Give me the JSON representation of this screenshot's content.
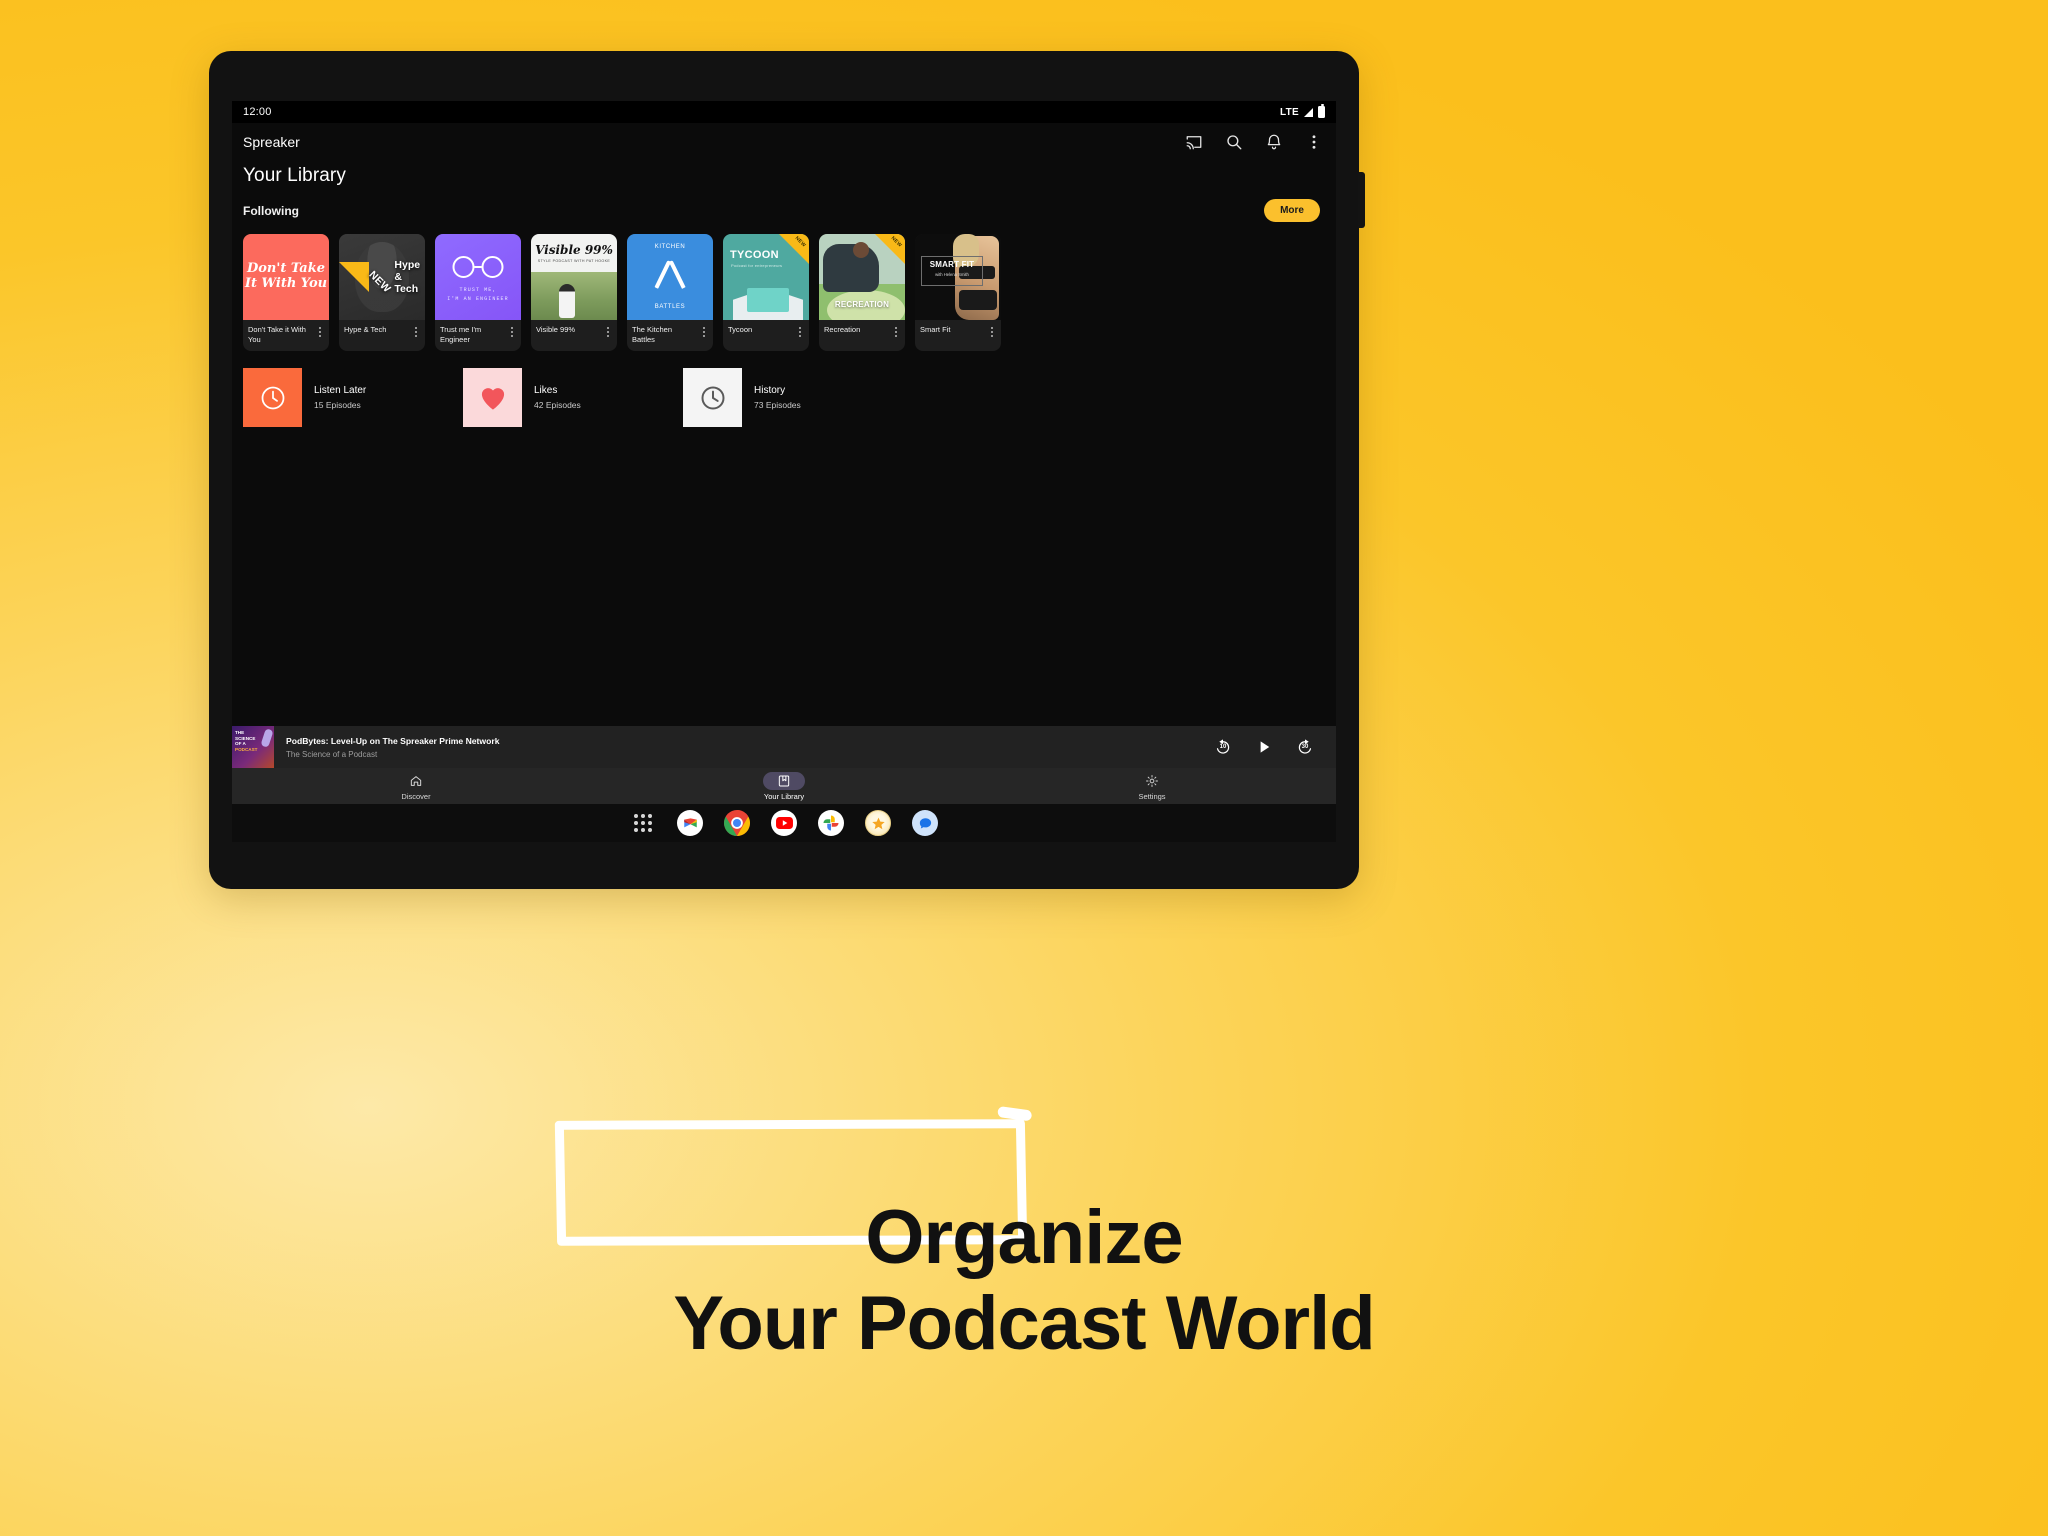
{
  "device": {
    "camera_icon": "front-camera-lens"
  },
  "status_bar": {
    "time": "12:00",
    "network": "LTE",
    "signal_icon": "signal-bars-icon",
    "battery_icon": "battery-full-icon"
  },
  "app_bar": {
    "title": "Spreaker",
    "icons": [
      {
        "name": "cast-icon"
      },
      {
        "name": "search-icon"
      },
      {
        "name": "notifications-bell-icon"
      },
      {
        "name": "overflow-menu-icon"
      }
    ]
  },
  "page": {
    "title": "Your Library",
    "section_label": "Following",
    "more_label": "More"
  },
  "following": [
    {
      "title": "Don't Take it With You",
      "art_title": "Don't Take It With You",
      "badge": "",
      "art": "dont"
    },
    {
      "title": "Hype & Tech",
      "art_title": "Hype & Tech",
      "badge": "NEW",
      "art": "hype"
    },
    {
      "title": "Trust me I'm Engineer",
      "art_line1": "TRUST ME,",
      "art_line2": "I'M AN ENGINEER",
      "badge": "",
      "art": "trust"
    },
    {
      "title": "Visible 99%",
      "art_title": "Visible 99%",
      "art_sub": "STYLE PODCAST WITH PAT HOOKE",
      "badge": "",
      "art": "visible"
    },
    {
      "title": "The Kitchen Battles",
      "art_line1": "KITCHEN",
      "art_line2": "BATTLES",
      "badge": "",
      "art": "kitchen"
    },
    {
      "title": "Tycoon",
      "art_title": "TYCOON",
      "art_sub": "Podcast for entrepreneurs",
      "badge": "NEW",
      "art": "tycoon"
    },
    {
      "title": "Recreation",
      "art_title": "RECREATION",
      "badge": "NEW",
      "art": "recreation"
    },
    {
      "title": "Smart Fit",
      "art_title": "SMART FIT",
      "art_sub": "with Helena Smith",
      "badge": "",
      "art": "smartfit"
    }
  ],
  "quick_rows": [
    {
      "title": "Listen Later",
      "subtitle": "15 Episodes",
      "icon": "clock-icon",
      "color": "#FA6A3C"
    },
    {
      "title": "Likes",
      "subtitle": "42 Episodes",
      "icon": "heart-icon",
      "color": "#FBD9DA"
    },
    {
      "title": "History",
      "subtitle": "73 Episodes",
      "icon": "history-clock-icon",
      "color": "#F4F4F4"
    }
  ],
  "player": {
    "artwork_line1": "THE",
    "artwork_line2": "SCIENCE",
    "artwork_line3": "OF A",
    "artwork_line4": "PODCAST",
    "title": "PodBytes: Level-Up on The Spreaker Prime Network",
    "subtitle": "The Science of a Podcast",
    "rewind_label": "10",
    "forward_label": "30",
    "play_icon": "play-icon"
  },
  "bottom_nav": [
    {
      "label": "Discover",
      "icon": "home-icon",
      "active": false
    },
    {
      "label": "Your Library",
      "icon": "library-bookmark-icon",
      "active": true
    },
    {
      "label": "Settings",
      "icon": "gear-icon",
      "active": false
    }
  ],
  "dock": [
    {
      "name": "app-drawer-icon"
    },
    {
      "name": "gmail-icon"
    },
    {
      "name": "chrome-icon"
    },
    {
      "name": "youtube-icon"
    },
    {
      "name": "google-photos-icon"
    },
    {
      "name": "star-app-icon"
    },
    {
      "name": "messages-icon"
    }
  ],
  "caption": {
    "line1": "Organize",
    "line2": "Your Podcast World"
  },
  "colors": {
    "accent": "#FBC02D",
    "background": "#FBC629",
    "surface": "#1e1e1e",
    "badge": "#F9B917"
  }
}
